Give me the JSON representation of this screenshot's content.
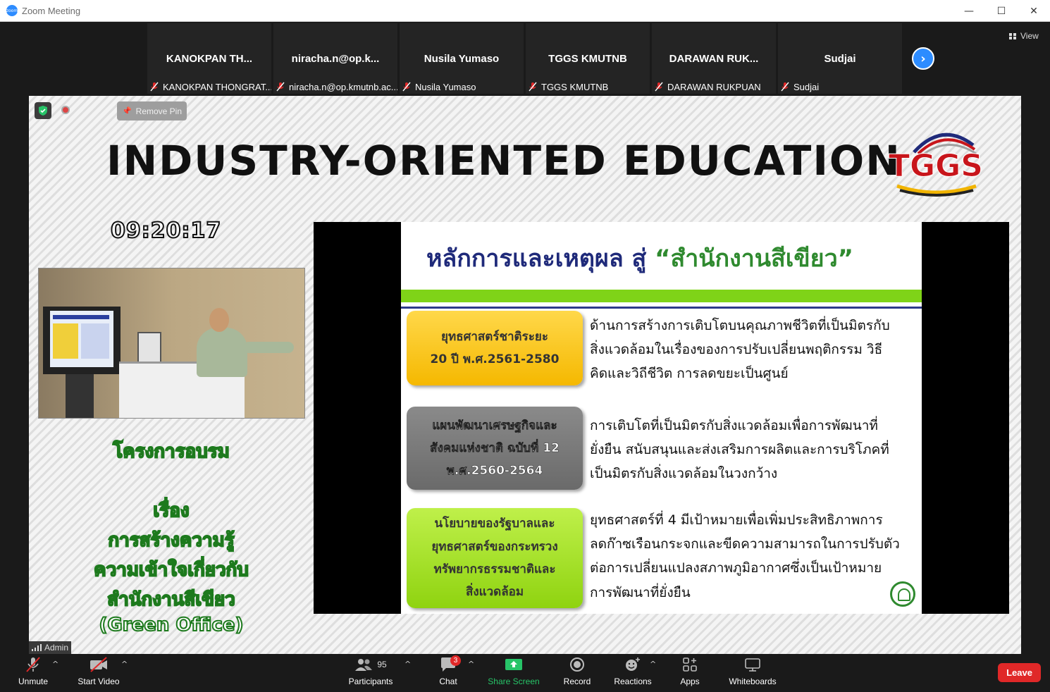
{
  "window": {
    "title": "Zoom Meeting",
    "controls": [
      "—",
      "☐",
      "✕"
    ]
  },
  "strip": {
    "view_label": "View",
    "participants": [
      {
        "tile_name": "KANOKPAN  TH...",
        "footer_name": "KANOKPAN THONGRAT..."
      },
      {
        "tile_name": "niracha.n@op.k...",
        "footer_name": "niracha.n@op.kmutnb.ac..."
      },
      {
        "tile_name": "Nusila Yumaso",
        "footer_name": "Nusila Yumaso"
      },
      {
        "tile_name": "TGGS KMUTNB",
        "footer_name": "TGGS KMUTNB"
      },
      {
        "tile_name": "DARAWAN  RUK...",
        "footer_name": "DARAWAN RUKPUAN"
      },
      {
        "tile_name": "Sudjai",
        "footer_name": "Sudjai"
      }
    ]
  },
  "share": {
    "remove_pin_label": "Remove Pin",
    "slide_title": "INDUSTRY-ORIENTED EDUCATION",
    "logo_text": "TGGS",
    "clock": "09:20:17",
    "left_text": {
      "project": "โครงการอบรม",
      "topic": "เรื่อง",
      "line1": "การสร้างความรู้",
      "line2": "ความเข้าใจเกี่ยวกับ",
      "line3": "สำนักงานสีเขียว",
      "line4": "(Green Office)"
    },
    "slide2": {
      "title_main": "หลักการและเหตุผล สู่ ",
      "title_quote": "“สำนักงานสีเขียว”",
      "boxes": [
        {
          "l1": "ยุทธศาสตร์ชาติระยะ",
          "l2": "20 ปี พ.ศ.2561-2580",
          "l3": "",
          "l4": ""
        },
        {
          "l1": "แผนพัฒนาเศรษฐกิจและ",
          "l2": "สังคมแห่งชาติ ฉบับที่ 12",
          "l3": "พ.ศ.2560-2564",
          "l4": ""
        },
        {
          "l1": "นโยบายของรัฐบาลและ",
          "l2": "ยุทธศาสตร์ของกระทรวง",
          "l3": "ทรัพยากรธรรมชาติและ",
          "l4": "สิ่งแวดล้อม"
        }
      ],
      "descriptions": [
        {
          "l1": "ด้านการสร้างการเติบโตบนคุณภาพชีวิตที่เป็นมิตรกับ",
          "l2": "สิ่งแวดล้อมในเรื่องของการปรับเปลี่ยนพฤติกรรม วิธี",
          "l3": "คิดและวิถีชีวิต การลดขยะเป็นศูนย์",
          "l4": ""
        },
        {
          "l1": "การเติบโตที่เป็นมิตรกับสิ่งแวดล้อมเพื่อการพัฒนาที่",
          "l2": "ยั่งยืน สนับสนุนและส่งเสริมการผลิตและการบริโภคที่",
          "l3": "เป็นมิตรกับสิ่งแวดล้อมในวงกว้าง",
          "l4": ""
        },
        {
          "l1": "ยุทธศาสตร์ที่ 4 มีเป้าหมายเพื่อเพิ่มประสิทธิภาพการ",
          "l2": "ลดก๊าซเรือนกระจกและขีดความสามารถในการปรับตัว",
          "l3": "ต่อการเปลี่ยนแปลงสภาพภูมิอากาศซึ่งเป็นเป้าหมาย",
          "l4": "การพัฒนาที่ยั่งยืน"
        }
      ]
    },
    "admin_label": "Admin"
  },
  "toolbar": {
    "unmute": "Unmute",
    "start_video": "Start Video",
    "participants": "Participants",
    "participants_count": "95",
    "chat": "Chat",
    "chat_badge": "3",
    "share_screen": "Share Screen",
    "record": "Record",
    "reactions": "Reactions",
    "apps": "Apps",
    "whiteboards": "Whiteboards",
    "leave": "Leave"
  },
  "colors": {
    "accent": "#2d8cff",
    "leave": "#e02828",
    "share_green": "#27c468",
    "slide_bar": "#7fd318"
  }
}
